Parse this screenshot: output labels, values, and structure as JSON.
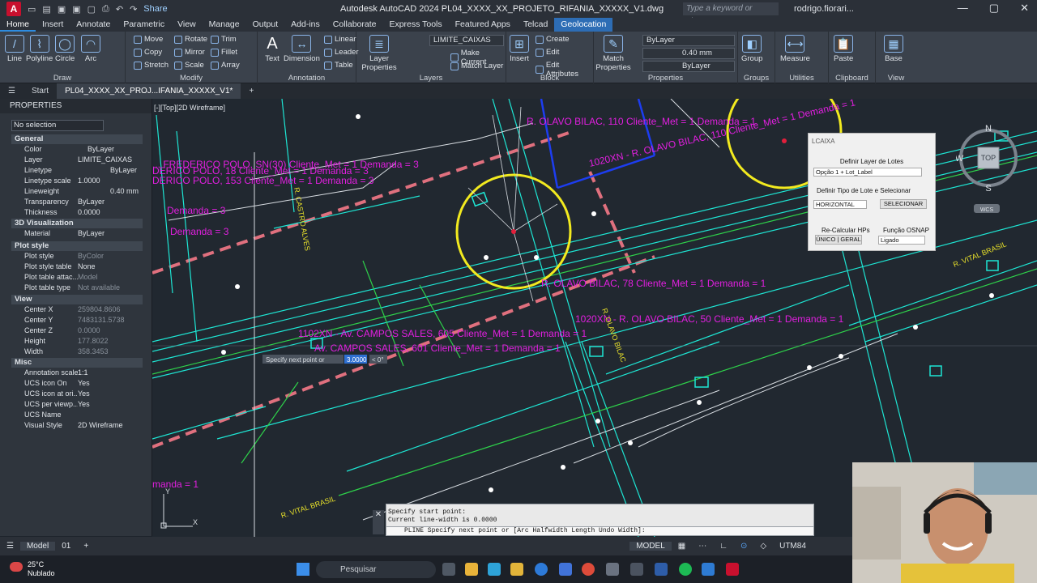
{
  "window": {
    "title": "Autodesk AutoCAD 2024   PL04_XXXX_XX_PROJETO_RIFANIA_XXXXX_V1.dwg",
    "share_label": "Share",
    "search_placeholder": "Type a keyword or phrase",
    "user": "rodrigo.fiorari..."
  },
  "ribbon_tabs": [
    "Home",
    "Insert",
    "Annotate",
    "Parametric",
    "View",
    "Manage",
    "Output",
    "Add-ins",
    "Collaborate",
    "Express Tools",
    "Featured Apps",
    "Telcad",
    "Geolocation"
  ],
  "ribbon": {
    "draw": {
      "title": "Draw",
      "tools": [
        "Line",
        "Polyline",
        "Circle",
        "Arc"
      ]
    },
    "modify": {
      "title": "Modify",
      "tools": [
        "Move",
        "Rotate",
        "Trim",
        "Copy",
        "Mirror",
        "Fillet",
        "Stretch",
        "Scale",
        "Array"
      ]
    },
    "annotation": {
      "title": "Annotation",
      "tools": [
        "Text",
        "Dimension",
        "Linear",
        "Leader",
        "Table"
      ]
    },
    "layers": {
      "title": "Layers",
      "layer_properties": "Layer Properties",
      "current_layer": "LIMITE_CAIXAS",
      "tools": [
        "Make Current",
        "Match Layer"
      ]
    },
    "block": {
      "title": "Block",
      "insert": "Insert",
      "tools": [
        "Create",
        "Edit",
        "Edit Attributes"
      ]
    },
    "properties": {
      "title": "Properties",
      "match": "Match Properties",
      "color": "ByLayer",
      "lineweight": "0.40 mm",
      "linetype": "ByLayer"
    },
    "groups": {
      "title": "Groups",
      "tool": "Group"
    },
    "utilities": {
      "title": "Utilities",
      "tool": "Measure"
    },
    "clipboard": {
      "title": "Clipboard",
      "tool": "Paste"
    },
    "view": {
      "title": "View",
      "tool": "Base"
    }
  },
  "file_tabs": {
    "start": "Start",
    "active": "PL04_XXXX_XX_PROJ...IFANIA_XXXXX_V1*"
  },
  "properties_panel": {
    "title": "PROPERTIES",
    "selection": "No selection",
    "sections": [
      {
        "name": "General",
        "rows": [
          [
            "Color",
            "ByLayer"
          ],
          [
            "Layer",
            "LIMITE_CAIXAS"
          ],
          [
            "Linetype",
            "ByLayer"
          ],
          [
            "Linetype scale",
            "1.0000"
          ],
          [
            "Lineweight",
            "0.40 mm"
          ],
          [
            "Transparency",
            "ByLayer"
          ],
          [
            "Thickness",
            "0.0000"
          ]
        ]
      },
      {
        "name": "3D Visualization",
        "rows": [
          [
            "Material",
            "ByLayer"
          ]
        ]
      },
      {
        "name": "Plot style",
        "rows": [
          [
            "Plot style",
            "ByColor"
          ],
          [
            "Plot style table",
            "None"
          ],
          [
            "Plot table attac...",
            "Model"
          ],
          [
            "Plot table type",
            "Not available"
          ]
        ]
      },
      {
        "name": "View",
        "rows": [
          [
            "Center X",
            "259804.8606"
          ],
          [
            "Center Y",
            "7483131.5738"
          ],
          [
            "Center Z",
            "0.0000"
          ],
          [
            "Height",
            "177.8022"
          ],
          [
            "Width",
            "358.3453"
          ]
        ]
      },
      {
        "name": "Misc",
        "rows": [
          [
            "Annotation scale",
            "1:1"
          ],
          [
            "UCS icon On",
            "Yes"
          ],
          [
            "UCS icon at ori...",
            "Yes"
          ],
          [
            "UCS per viewp...",
            "Yes"
          ],
          [
            "UCS Name",
            ""
          ],
          [
            "Visual Style",
            "2D Wireframe"
          ]
        ]
      }
    ]
  },
  "viewport_label": "[-][Top][2D Wireframe]",
  "drawing_labels": [
    "R. OLAVO BILAC, 110 Cliente_Met = 1  Demanda = 1",
    "... FREDERICO POLO, SN(30) Cliente_Met = 1  Demanda = 3",
    "DERICO POLO, 18 Cliente_Met = 1  Demanda = 3",
    "DERICO POLO, 153 Cliente_Met = 1  Demanda = 3",
    "Demanda = 3",
    "Demanda = 3",
    "R. OLAVO BILAC, 78 Cliente_Met = 1  Demanda = 1",
    "1020XN - R. OLAVO BILAC, 50 Cliente_Met = 1  Demanda = 1",
    "1102XN - Av. CAMPOS SALES, 605 Cliente_Met = 1  Demanda = 1",
    "Av. CAMPOS SALES, 601 Cliente_Met = 1  Demanda = 1",
    "manda = 1",
    "1020XN - R. OLAVO BILAC, 110 Cliente_Met = 1  Demanda = 1"
  ],
  "street_labels": [
    "R. CASTRO ALVES",
    "R. OLAVO BILAC",
    "R. VITAL BRASIL",
    "R. VITAL BRASIL"
  ],
  "dynamic_input": {
    "prompt": "Specify next point or",
    "value": "3.0000",
    "angle": "< 0°"
  },
  "lcaixa_dialog": {
    "title": "LCAIXA",
    "layer_label": "Definir Layer de Lotes",
    "layer_value": "Opção 1 + Lot_Label",
    "type_label": "Definir Tipo de Lote e Selecionar",
    "type_value": "HORIZONTAL",
    "select_button": "SELECIONAR",
    "recalc_label": "Re-Calcular HPs",
    "recalc_button": "ÚNICO | GERAL",
    "osnap_label": "Função OSNAP",
    "osnap_value": "Ligado"
  },
  "navcube": {
    "north": "N",
    "south": "S",
    "west": "W",
    "face": "TOP",
    "wcs": "WCS"
  },
  "command_line": {
    "history": [
      "Specify start point:",
      "Current line-width is 0.0000"
    ],
    "current": "PLINE Specify next point or [Arc Halfwidth Length Undo Width]:"
  },
  "status_bar": {
    "model_tab": "Model",
    "layout_tab": "01",
    "model_label": "MODEL",
    "coord_system": "UTM84"
  },
  "taskbar": {
    "temperature": "25°C",
    "weather": "Nublado",
    "search": "Pesquisar"
  },
  "colors": {
    "accent": "#2d8ce0",
    "magenta": "#e21fe0",
    "cyan": "#1ee6d4",
    "yellow": "#f2ea1f",
    "pink_dashed": "#e0707e"
  }
}
